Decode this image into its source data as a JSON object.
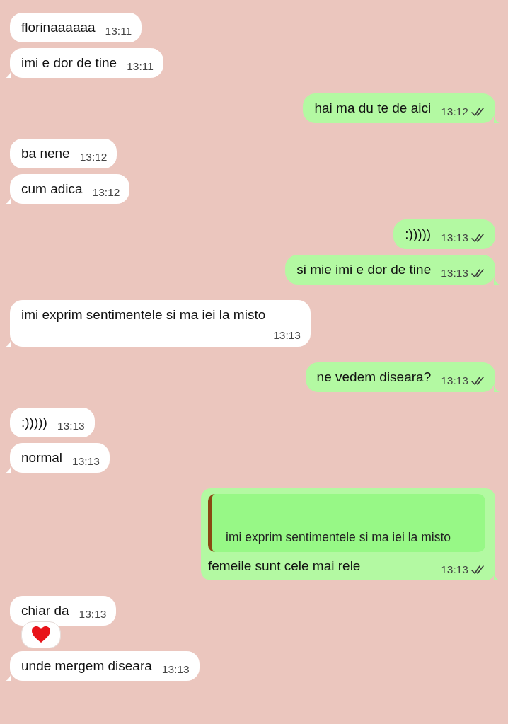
{
  "messages": [
    {
      "outgoing": false,
      "text": "florinaaaaaa",
      "time": "13:11"
    },
    {
      "outgoing": false,
      "text": "imi e dor de tine",
      "time": "13:11"
    },
    {
      "outgoing": true,
      "text": "hai ma du te de aici",
      "time": "13:12",
      "read": true
    },
    {
      "outgoing": false,
      "text": "ba nene",
      "time": "13:12"
    },
    {
      "outgoing": false,
      "text": "cum adica",
      "time": "13:12"
    },
    {
      "outgoing": true,
      "text": ":)))))",
      "time": "13:13",
      "read": true
    },
    {
      "outgoing": true,
      "text": "si mie imi e dor de tine",
      "time": "13:13",
      "read": true
    },
    {
      "outgoing": false,
      "text": "imi exprim sentimentele si ma iei la misto",
      "time": "13:13"
    },
    {
      "outgoing": true,
      "text": "ne vedem diseara?",
      "time": "13:13",
      "read": true
    },
    {
      "outgoing": false,
      "text": ":)))))",
      "time": "13:13"
    },
    {
      "outgoing": false,
      "text": "normal",
      "time": "13:13"
    },
    {
      "outgoing": true,
      "quote": "imi exprim sentimentele si ma iei la misto",
      "text": "femeile sunt cele mai rele",
      "time": "13:13",
      "read": true
    },
    {
      "outgoing": false,
      "text": "chiar da",
      "time": "13:13",
      "reaction": {
        "kind": "heart"
      }
    },
    {
      "outgoing": false,
      "text": "unde mergem diseara",
      "time": "13:13"
    }
  ]
}
